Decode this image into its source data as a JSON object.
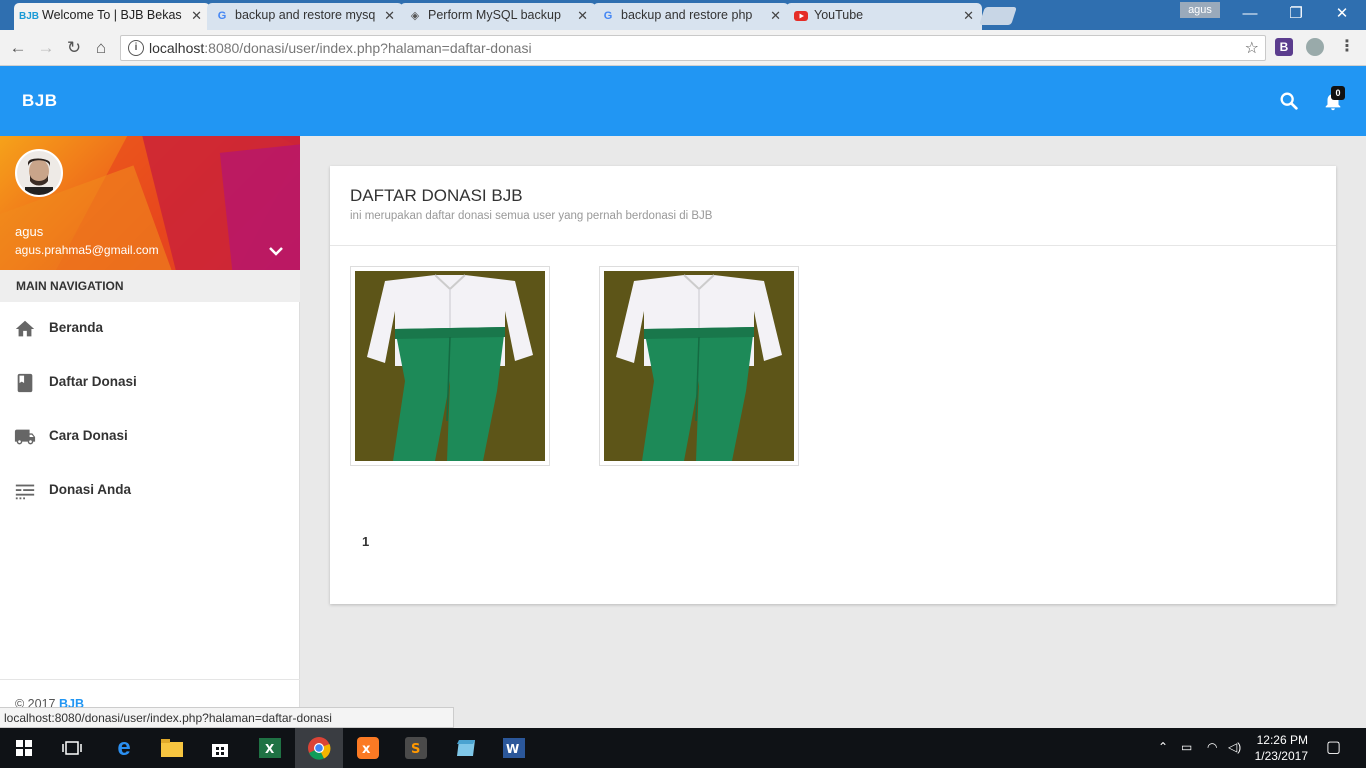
{
  "browser": {
    "tabs": [
      {
        "title": "Welcome To | BJB Bekas",
        "favicon": "bjb-favicon",
        "active": true
      },
      {
        "title": "backup and restore mysql",
        "favicon": "google-favicon",
        "active": false
      },
      {
        "title": "Perform MySQL backup",
        "favicon": "diamond-favicon",
        "active": false
      },
      {
        "title": "backup and restore php",
        "favicon": "google-favicon",
        "active": false
      },
      {
        "title": "YouTube",
        "favicon": "youtube-favicon",
        "active": false
      }
    ],
    "profile": "agus",
    "url_host": "localhost",
    "url_rest": ":8080/donasi/user/index.php?halaman=daftar-donasi",
    "status_url": "localhost:8080/donasi/user/index.php?halaman=daftar-donasi"
  },
  "app": {
    "brand": "BJB",
    "notification_count": "0",
    "accent": "#2196f3"
  },
  "user": {
    "name": "agus",
    "email": "agus.prahma5@gmail.com"
  },
  "sidebar": {
    "heading": "MAIN NAVIGATION",
    "items": [
      {
        "label": "Beranda",
        "icon": "home-icon"
      },
      {
        "label": "Daftar Donasi",
        "icon": "book-icon"
      },
      {
        "label": "Cara Donasi",
        "icon": "truck-icon"
      },
      {
        "label": "Donasi Anda",
        "icon": "list-icon"
      }
    ],
    "footer_prefix": "© 2017 ",
    "footer_link": "BJB"
  },
  "main": {
    "title": "DAFTAR DONASI BJB",
    "subtitle": "ini merupakan daftar donasi semua user yang pernah berdonasi di BJB",
    "items": [
      {
        "image": "school-uniform-photo"
      },
      {
        "image": "school-uniform-photo"
      }
    ],
    "pagination": [
      "1"
    ]
  },
  "taskbar": {
    "time": "12:26 PM",
    "date": "1/23/2017"
  }
}
